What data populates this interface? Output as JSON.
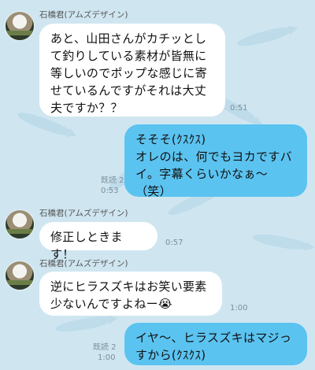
{
  "messages": [
    {
      "sender": "石橋君(アムズデザイン)",
      "text": "あと、山田さんがカチッとして釣りしている素材が皆無に等しいのでポップな感じに寄せているんですがそれは大丈夫ですか？？",
      "time": "0:51"
    },
    {
      "text": "そそそ(ｸｽｸｽ)\nオレのは、何でもヨカですバイ。字幕くらいかなぁ〜（笑）",
      "read": "既読 2",
      "time": "0:53"
    },
    {
      "sender": "石橋君(アムズデザイン)",
      "text": "修正しときます！",
      "time": "0:57"
    },
    {
      "sender": "石橋君(アムズデザイン)",
      "text": "逆にヒラスズキはお笑い要素少ないんですよねー😭",
      "time": "1:00"
    },
    {
      "text": "イヤ〜、ヒラスズキはマジっすから(ｸｽｸｽ)",
      "read": "既読 2",
      "time": "1:00"
    }
  ]
}
